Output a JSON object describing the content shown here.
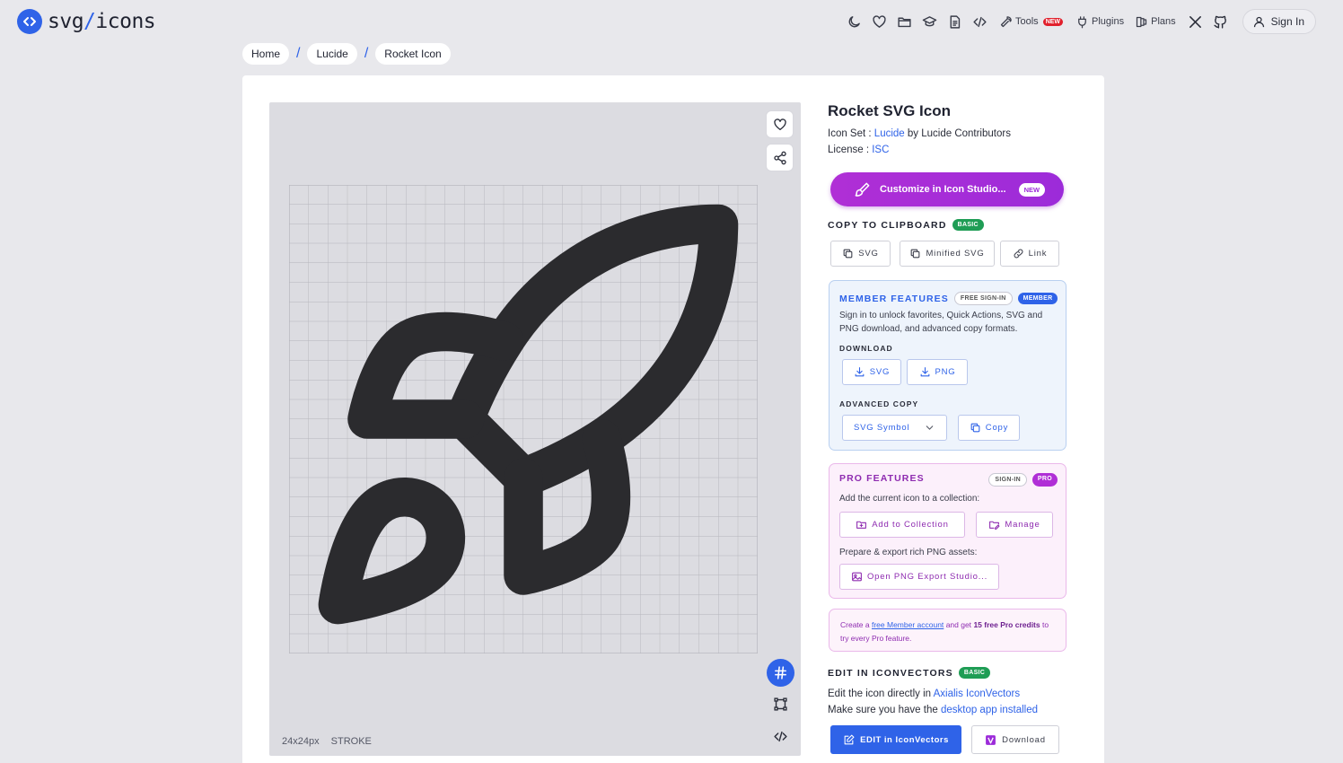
{
  "header": {
    "logo_prefix": "svg",
    "logo_slash": "/",
    "logo_suffix": "icons",
    "nav": {
      "tools_label": "Tools",
      "tools_badge": "NEW",
      "plugins_label": "Plugins",
      "plans_label": "Plans",
      "signin_label": "Sign In"
    }
  },
  "breadcrumb": {
    "items": [
      "Home",
      "Lucide",
      "Rocket Icon"
    ],
    "separator": "/"
  },
  "preview": {
    "size_label": "24x24px",
    "style_label": "STROKE"
  },
  "details": {
    "title": "Rocket SVG Icon",
    "icon_set_label": "Icon Set :",
    "icon_set_name": "Lucide",
    "icon_set_author": "by Lucide Contributors",
    "license_label": "License :",
    "license_name": "ISC"
  },
  "customize": {
    "label": "Customize in Icon Studio...",
    "badge": "NEW"
  },
  "clipboard": {
    "title": "COPY TO CLIPBOARD",
    "badge": "BASIC",
    "buttons": [
      "SVG",
      "Minified SVG",
      "Link"
    ]
  },
  "member": {
    "title": "MEMBER FEATURES",
    "badge_signin": "FREE SIGN-IN",
    "badge_member": "MEMBER",
    "description_line1": "Sign in to unlock favorites, Quick Actions, SVG and",
    "description_line2": "PNG download, and advanced copy formats.",
    "download_title": "DOWNLOAD",
    "download_buttons": [
      "SVG",
      "PNG"
    ],
    "advanced_title": "ADVANCED COPY",
    "format_value": "SVG Symbol",
    "copy_label": "Copy"
  },
  "pro": {
    "title": "PRO FEATURES",
    "badge_signin": "SIGN-IN",
    "badge_pro": "PRO",
    "collection_text": "Add the current icon to a collection:",
    "add_collection_label": "Add to Collection",
    "manage_label": "Manage",
    "export_text": "Prepare & export rich PNG assets:",
    "png_studio_label": "Open PNG Export Studio..."
  },
  "credits": {
    "text_before": "Create a",
    "link": "free Member account",
    "text_middle": "and get",
    "bold": "15 free Pro credits",
    "text_after": "to try every Pro feature."
  },
  "iconvectors": {
    "title": "EDIT IN ICONVECTORS",
    "badge": "BASIC",
    "line1_text": "Edit the icon directly in",
    "line1_link": "Axialis IconVectors",
    "line2_text": "Make sure you have the",
    "line2_link": "desktop app installed",
    "edit_label": "EDIT in IconVectors",
    "download_label": "Download"
  },
  "colors": {
    "accent_blue": "#2f63e8",
    "pro_purple": "#b02fd6",
    "basic_green": "#1f9d55",
    "tools_red": "#e1202c"
  }
}
